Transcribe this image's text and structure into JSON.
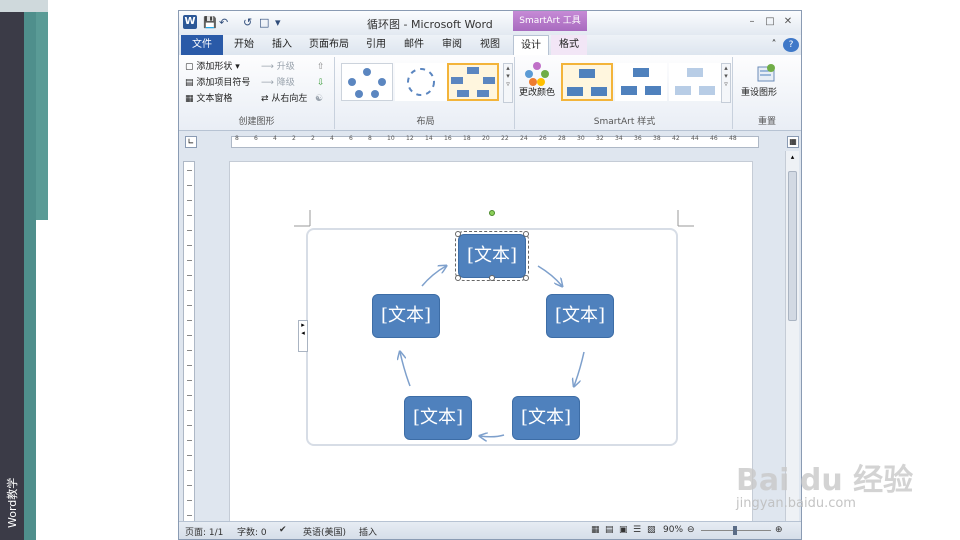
{
  "slide": {
    "side_label": "Word教学"
  },
  "window": {
    "title": "循环图 - Microsoft Word",
    "contextual_tab": "SmartArt 工具",
    "app_icon": "W"
  },
  "tabs": [
    "文件",
    "开始",
    "插入",
    "页面布局",
    "引用",
    "邮件",
    "审阅",
    "视图",
    "设计",
    "格式"
  ],
  "ribbon": {
    "create_group": {
      "label": "创建图形",
      "items": [
        "添加形状",
        "添加项目符号",
        "文本窗格",
        "升级",
        "降级",
        "从右向左"
      ]
    },
    "layout_group": {
      "label": "布局"
    },
    "styles_group": {
      "label": "SmartArt 样式",
      "change_colors": "更改颜色"
    },
    "reset_group": {
      "label": "重置",
      "reset": "重设图形"
    }
  },
  "ruler": {
    "ticks": [
      "8",
      "6",
      "4",
      "2",
      "2",
      "4",
      "6",
      "8",
      "10",
      "12",
      "14",
      "16",
      "18",
      "20",
      "22",
      "24",
      "26",
      "28",
      "30",
      "32",
      "34",
      "36",
      "38",
      "42",
      "44",
      "46",
      "48"
    ]
  },
  "smartart": {
    "nodes": [
      "[文本]",
      "[文本]",
      "[文本]",
      "[文本]",
      "[文本]"
    ]
  },
  "status": {
    "page": "页面: 1/1",
    "words": "字数: 0",
    "language": "英语(美国)",
    "mode": "插入",
    "zoom": "90%"
  },
  "watermark": {
    "brand": "Bai du 经验",
    "url": "jingyan.baidu.com"
  },
  "colors": {
    "node": "#4f81bd",
    "file_tab": "#2a5aa8",
    "contextual": "#a86bbf"
  }
}
